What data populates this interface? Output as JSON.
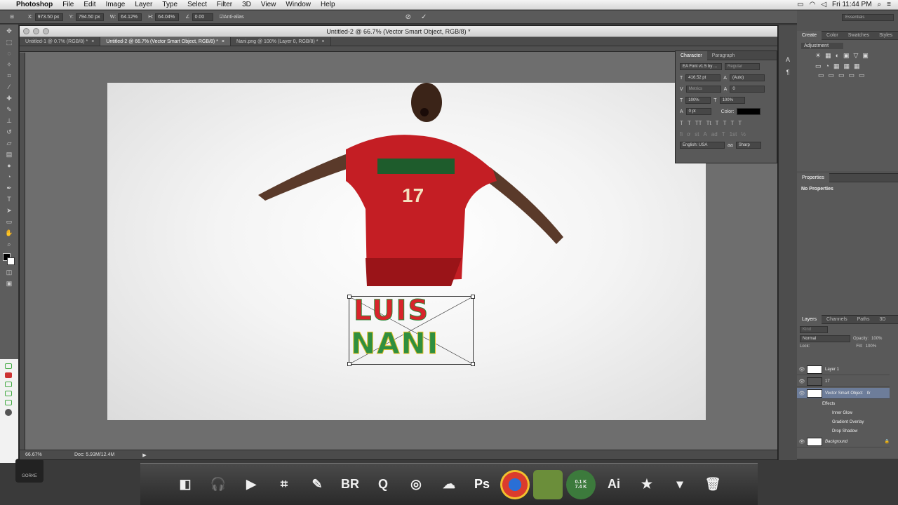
{
  "menubar": {
    "items": [
      "Photoshop",
      "File",
      "Edit",
      "Image",
      "Layer",
      "Type",
      "Select",
      "Filter",
      "3D",
      "View",
      "Window",
      "Help"
    ],
    "clock": "Fri 11:44 PM"
  },
  "options": {
    "x": "973.50 px",
    "y": "794.50 px",
    "w": "64.12%",
    "h": "64.04%",
    "angle": "0.00",
    "antialias": "Anti-alias"
  },
  "document": {
    "window_title": "Untitled-2 @ 66.7% (Vector Smart Object, RGB/8) *",
    "tabs": [
      {
        "label": "Untitled-1 @ 0.7% (RGB/8) *",
        "active": false
      },
      {
        "label": "Untitled-2 @ 66.7% (Vector Smart Object, RGB/8) *",
        "active": true
      },
      {
        "label": "Nani.png @ 100% (Layer 0, RGB/8) *",
        "active": false
      }
    ],
    "zoom": "66.67%",
    "doc_size": "Doc: 5.93M/12.4M",
    "canvas_text_line1": "LUIS",
    "canvas_text_line2": "NANI",
    "jersey_number": "17"
  },
  "character_panel": {
    "tabs": [
      "Character",
      "Paragraph"
    ],
    "font": "EA Font v1.5 by ...",
    "style": "Regular",
    "size": "416.52 pt",
    "leading": "(Auto)",
    "kerning": "Metrics",
    "tracking": "0",
    "vscale": "100%",
    "hscale": "100%",
    "baseline": "0 pt",
    "color_label": "Color:",
    "language": "English: USA",
    "antialias": "Sharp"
  },
  "right_panels": {
    "workspace": "Essentials",
    "adjust_tabs": [
      "Create",
      "Color",
      "Swatches",
      "Styles"
    ],
    "adjust_title": "Adjustment",
    "properties_title": "Properties",
    "properties_empty": "No Properties",
    "layers_tabs": [
      "Layers",
      "Channels",
      "Paths",
      "3D"
    ],
    "kind": "Kind",
    "blend": "Normal",
    "opacity_label": "Opacity:",
    "opacity": "100%",
    "lock_label": "Lock:",
    "fill_label": "Fill:",
    "fill": "100%",
    "layers": [
      "Layer 1",
      "17",
      "Vector Smart Object",
      "Effects",
      "Inner Glow",
      "Gradient Overlay",
      "Drop Shadow",
      "Background"
    ]
  },
  "dock": {
    "items": [
      "finder",
      "headphones",
      "facetime",
      "grid",
      "pen",
      "BR",
      "Q",
      "safari",
      "cloud",
      "Ps",
      "chrome",
      "minecraft",
      "wordpress",
      "Ai",
      "star-folder",
      "download-folder",
      "trash"
    ],
    "wp_up": "0.1 K",
    "wp_down": "7.4 K"
  }
}
